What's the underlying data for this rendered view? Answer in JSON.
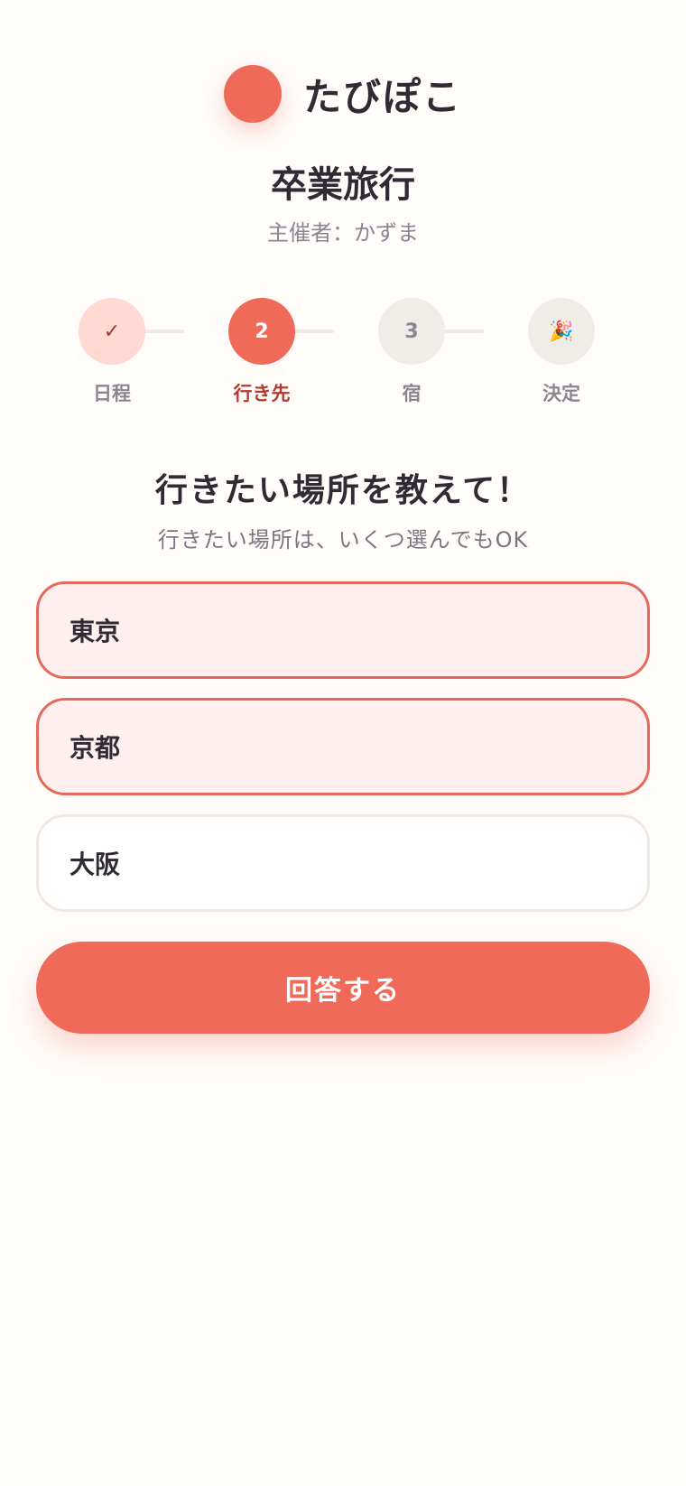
{
  "brand": {
    "name": "たびぽこ",
    "logo_icon": "circle-logo-icon",
    "accent": "#ef6a59"
  },
  "trip": {
    "title": "卒業旅行",
    "organizer": "主催者：かずま"
  },
  "steps": [
    {
      "icon": "✓",
      "label": "日程",
      "state": "done"
    },
    {
      "icon": "2",
      "label": "行き先",
      "state": "active"
    },
    {
      "icon": "3",
      "label": "宿",
      "state": "todo"
    },
    {
      "icon": "🎉",
      "label": "決定",
      "state": "todo"
    }
  ],
  "question": {
    "title": "行きたい場所を教えて！",
    "hint": "行きたい場所は、いくつ選んでもOK"
  },
  "options": [
    {
      "label": "東京",
      "selected": true
    },
    {
      "label": "京都",
      "selected": true
    },
    {
      "label": "大阪",
      "selected": false
    }
  ],
  "submit": {
    "label": "回答する"
  },
  "colors": {
    "accent": "#ef6a59",
    "selected_border": "#e36a5c",
    "selected_bg": "#fff0ef",
    "background": "#fffcfa"
  }
}
